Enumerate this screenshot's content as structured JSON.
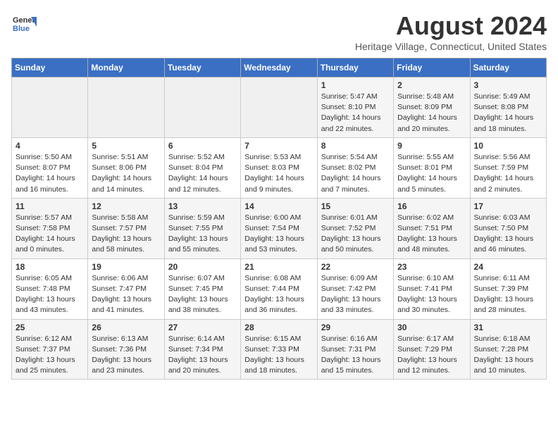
{
  "header": {
    "logo_line1": "General",
    "logo_line2": "Blue",
    "title": "August 2024",
    "subtitle": "Heritage Village, Connecticut, United States"
  },
  "days_of_week": [
    "Sunday",
    "Monday",
    "Tuesday",
    "Wednesday",
    "Thursday",
    "Friday",
    "Saturday"
  ],
  "weeks": [
    [
      {
        "day": "",
        "info": ""
      },
      {
        "day": "",
        "info": ""
      },
      {
        "day": "",
        "info": ""
      },
      {
        "day": "",
        "info": ""
      },
      {
        "day": "1",
        "info": "Sunrise: 5:47 AM\nSunset: 8:10 PM\nDaylight: 14 hours\nand 22 minutes."
      },
      {
        "day": "2",
        "info": "Sunrise: 5:48 AM\nSunset: 8:09 PM\nDaylight: 14 hours\nand 20 minutes."
      },
      {
        "day": "3",
        "info": "Sunrise: 5:49 AM\nSunset: 8:08 PM\nDaylight: 14 hours\nand 18 minutes."
      }
    ],
    [
      {
        "day": "4",
        "info": "Sunrise: 5:50 AM\nSunset: 8:07 PM\nDaylight: 14 hours\nand 16 minutes."
      },
      {
        "day": "5",
        "info": "Sunrise: 5:51 AM\nSunset: 8:06 PM\nDaylight: 14 hours\nand 14 minutes."
      },
      {
        "day": "6",
        "info": "Sunrise: 5:52 AM\nSunset: 8:04 PM\nDaylight: 14 hours\nand 12 minutes."
      },
      {
        "day": "7",
        "info": "Sunrise: 5:53 AM\nSunset: 8:03 PM\nDaylight: 14 hours\nand 9 minutes."
      },
      {
        "day": "8",
        "info": "Sunrise: 5:54 AM\nSunset: 8:02 PM\nDaylight: 14 hours\nand 7 minutes."
      },
      {
        "day": "9",
        "info": "Sunrise: 5:55 AM\nSunset: 8:01 PM\nDaylight: 14 hours\nand 5 minutes."
      },
      {
        "day": "10",
        "info": "Sunrise: 5:56 AM\nSunset: 7:59 PM\nDaylight: 14 hours\nand 2 minutes."
      }
    ],
    [
      {
        "day": "11",
        "info": "Sunrise: 5:57 AM\nSunset: 7:58 PM\nDaylight: 14 hours\nand 0 minutes."
      },
      {
        "day": "12",
        "info": "Sunrise: 5:58 AM\nSunset: 7:57 PM\nDaylight: 13 hours\nand 58 minutes."
      },
      {
        "day": "13",
        "info": "Sunrise: 5:59 AM\nSunset: 7:55 PM\nDaylight: 13 hours\nand 55 minutes."
      },
      {
        "day": "14",
        "info": "Sunrise: 6:00 AM\nSunset: 7:54 PM\nDaylight: 13 hours\nand 53 minutes."
      },
      {
        "day": "15",
        "info": "Sunrise: 6:01 AM\nSunset: 7:52 PM\nDaylight: 13 hours\nand 50 minutes."
      },
      {
        "day": "16",
        "info": "Sunrise: 6:02 AM\nSunset: 7:51 PM\nDaylight: 13 hours\nand 48 minutes."
      },
      {
        "day": "17",
        "info": "Sunrise: 6:03 AM\nSunset: 7:50 PM\nDaylight: 13 hours\nand 46 minutes."
      }
    ],
    [
      {
        "day": "18",
        "info": "Sunrise: 6:05 AM\nSunset: 7:48 PM\nDaylight: 13 hours\nand 43 minutes."
      },
      {
        "day": "19",
        "info": "Sunrise: 6:06 AM\nSunset: 7:47 PM\nDaylight: 13 hours\nand 41 minutes."
      },
      {
        "day": "20",
        "info": "Sunrise: 6:07 AM\nSunset: 7:45 PM\nDaylight: 13 hours\nand 38 minutes."
      },
      {
        "day": "21",
        "info": "Sunrise: 6:08 AM\nSunset: 7:44 PM\nDaylight: 13 hours\nand 36 minutes."
      },
      {
        "day": "22",
        "info": "Sunrise: 6:09 AM\nSunset: 7:42 PM\nDaylight: 13 hours\nand 33 minutes."
      },
      {
        "day": "23",
        "info": "Sunrise: 6:10 AM\nSunset: 7:41 PM\nDaylight: 13 hours\nand 30 minutes."
      },
      {
        "day": "24",
        "info": "Sunrise: 6:11 AM\nSunset: 7:39 PM\nDaylight: 13 hours\nand 28 minutes."
      }
    ],
    [
      {
        "day": "25",
        "info": "Sunrise: 6:12 AM\nSunset: 7:37 PM\nDaylight: 13 hours\nand 25 minutes."
      },
      {
        "day": "26",
        "info": "Sunrise: 6:13 AM\nSunset: 7:36 PM\nDaylight: 13 hours\nand 23 minutes."
      },
      {
        "day": "27",
        "info": "Sunrise: 6:14 AM\nSunset: 7:34 PM\nDaylight: 13 hours\nand 20 minutes."
      },
      {
        "day": "28",
        "info": "Sunrise: 6:15 AM\nSunset: 7:33 PM\nDaylight: 13 hours\nand 18 minutes."
      },
      {
        "day": "29",
        "info": "Sunrise: 6:16 AM\nSunset: 7:31 PM\nDaylight: 13 hours\nand 15 minutes."
      },
      {
        "day": "30",
        "info": "Sunrise: 6:17 AM\nSunset: 7:29 PM\nDaylight: 13 hours\nand 12 minutes."
      },
      {
        "day": "31",
        "info": "Sunrise: 6:18 AM\nSunset: 7:28 PM\nDaylight: 13 hours\nand 10 minutes."
      }
    ]
  ]
}
